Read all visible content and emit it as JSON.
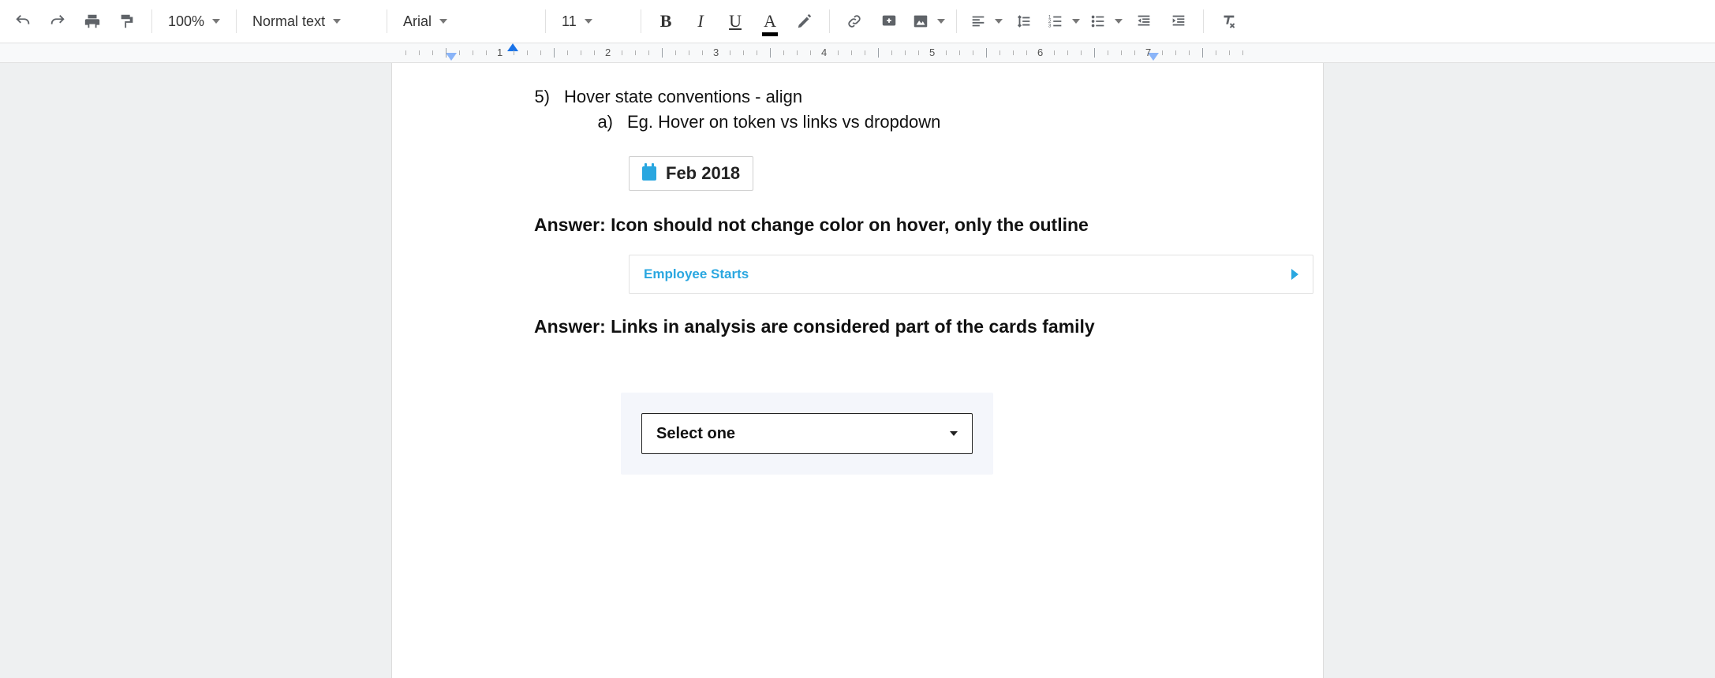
{
  "toolbar": {
    "zoom": "100%",
    "style": "Normal text",
    "font": "Arial",
    "size": "11"
  },
  "ruler": {
    "numbers": [
      "1",
      "2",
      "3",
      "4",
      "5",
      "6",
      "7"
    ]
  },
  "doc": {
    "item5_marker": "5)",
    "item5_text": "Hover state conventions - align",
    "item5a_marker": "a)",
    "item5a_text": "Eg. Hover on token vs links vs dropdown",
    "token_label": "Feb 2018",
    "answer1": "Answer: Icon should not change color on hover, only the outline",
    "link_label": "Employee Starts",
    "answer2": "Answer: Links in analysis are considered part of the cards family",
    "dropdown_label": "Select one"
  }
}
